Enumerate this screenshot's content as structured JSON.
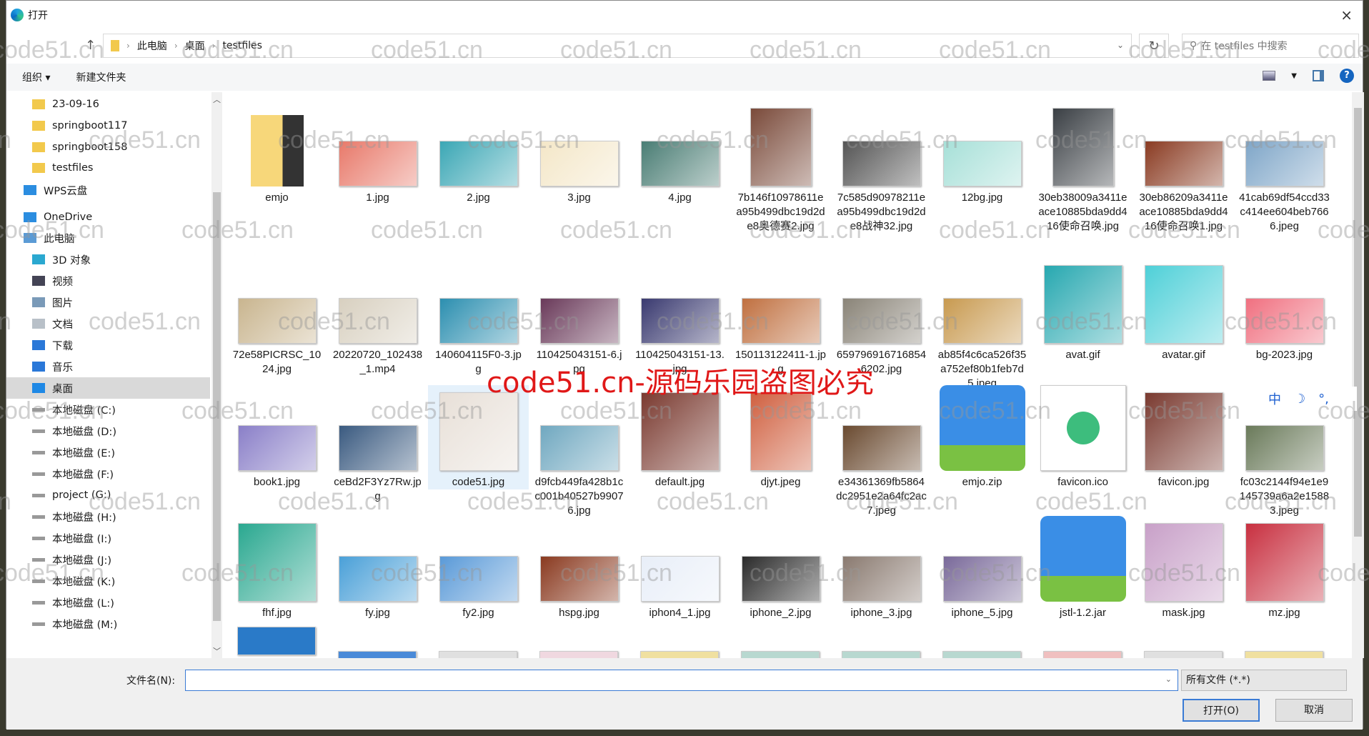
{
  "window": {
    "title": "打开",
    "close": "×"
  },
  "address": {
    "crumbs": [
      "此电脑",
      "桌面",
      "testfiles"
    ],
    "search_placeholder": "在 testfiles 中搜索"
  },
  "toolbar": {
    "organize": "组织 ▾",
    "new_folder": "新建文件夹"
  },
  "sidebar": {
    "items": [
      {
        "label": "23-09-16",
        "icon": "folder-icon"
      },
      {
        "label": "springboot117",
        "icon": "folder-icon"
      },
      {
        "label": "springboot158",
        "icon": "folder-icon"
      },
      {
        "label": "testfiles",
        "icon": "folder-icon"
      },
      {
        "label": "WPS云盘",
        "icon": "cloud-icon"
      },
      {
        "label": "OneDrive",
        "icon": "cloud-icon"
      },
      {
        "label": "此电脑",
        "icon": "computer-icon"
      },
      {
        "label": "3D 对象",
        "icon": "cube-icon"
      },
      {
        "label": "视频",
        "icon": "video-icon"
      },
      {
        "label": "图片",
        "icon": "picture-icon"
      },
      {
        "label": "文档",
        "icon": "document-icon"
      },
      {
        "label": "下载",
        "icon": "download-icon"
      },
      {
        "label": "音乐",
        "icon": "music-icon"
      },
      {
        "label": "桌面",
        "icon": "desktop-icon",
        "selected": true
      },
      {
        "label": "本地磁盘 (C:)",
        "icon": "drive-icon"
      },
      {
        "label": "本地磁盘 (D:)",
        "icon": "drive-icon"
      },
      {
        "label": "本地磁盘 (E:)",
        "icon": "drive-icon"
      },
      {
        "label": "本地磁盘 (F:)",
        "icon": "drive-icon"
      },
      {
        "label": "project (G:)",
        "icon": "drive-icon"
      },
      {
        "label": "本地磁盘 (H:)",
        "icon": "drive-icon"
      },
      {
        "label": "本地磁盘 (I:)",
        "icon": "drive-icon"
      },
      {
        "label": "本地磁盘 (J:)",
        "icon": "drive-icon"
      },
      {
        "label": "本地磁盘 (K:)",
        "icon": "drive-icon"
      },
      {
        "label": "本地磁盘 (L:)",
        "icon": "drive-icon"
      },
      {
        "label": "本地磁盘 (M:)",
        "icon": "drive-icon"
      }
    ]
  },
  "files": [
    {
      "name": "emjo",
      "kind": "folder",
      "color": "#f2c94c"
    },
    {
      "name": "1.jpg",
      "kind": "image",
      "color": "#e8796a"
    },
    {
      "name": "2.jpg",
      "kind": "image",
      "color": "#3ba7b5"
    },
    {
      "name": "3.jpg",
      "kind": "image",
      "color": "#f4e7c8"
    },
    {
      "name": "4.jpg",
      "kind": "image",
      "color": "#4a7d74"
    },
    {
      "name": "7b146f10978611ea95b499dbc19d2de8奥德赛2.jpg",
      "kind": "image-tall",
      "color": "#7a4a3a"
    },
    {
      "name": "7c585d90978211ea95b499dbc19d2de8战神32.jpg",
      "kind": "image",
      "color": "#555555"
    },
    {
      "name": "12bg.jpg",
      "kind": "image",
      "color": "#a7e0d8"
    },
    {
      "name": "30eb38009a3411eace10885bda9dd416使命召唤.jpg",
      "kind": "image-tall",
      "color": "#3a3f44"
    },
    {
      "name": "30eb86209a3411eace10885bda9dd416使命召唤1.jpg",
      "kind": "image",
      "color": "#8a3b22"
    },
    {
      "name": "41cab69df54ccd33c414ee604beb7666.jpeg",
      "kind": "image",
      "color": "#7fa6c8"
    },
    {
      "name": "72e58PICRSC_1024.jpg",
      "kind": "image",
      "color": "#c9b58f"
    },
    {
      "name": "20220720_102438_1.mp4",
      "kind": "video",
      "color": "#d8d0c0"
    },
    {
      "name": "140604115F0-3.jpg",
      "kind": "image",
      "color": "#2c8fb0"
    },
    {
      "name": "110425043151-6.jpg",
      "kind": "image",
      "color": "#6a3a5a"
    },
    {
      "name": "110425043151-13.jpg",
      "kind": "image",
      "color": "#3a3a70"
    },
    {
      "name": "150113122411-1.jpg",
      "kind": "image",
      "color": "#c07040"
    },
    {
      "name": "6597969167168546202.jpg",
      "kind": "image",
      "color": "#8a8478"
    },
    {
      "name": "ab85f4c6ca526f35a752ef80b1feb7d5.jpeg",
      "kind": "image",
      "color": "#c89a50"
    },
    {
      "name": "avat.gif",
      "kind": "image-square",
      "color": "#27a8b0"
    },
    {
      "name": "avatar.gif",
      "kind": "image-square",
      "color": "#4fd0d8"
    },
    {
      "name": "bg-2023.jpg",
      "kind": "image",
      "color": "#f07080"
    },
    {
      "name": "book1.jpg",
      "kind": "image",
      "color": "#8a7fc8"
    },
    {
      "name": "ceBd2F3Yz7Rw.jpg",
      "kind": "image",
      "color": "#3a5a80"
    },
    {
      "name": "code51.jpg",
      "kind": "image-square",
      "color": "#e8e0d8",
      "selected": true
    },
    {
      "name": "d9fcb449fa428b1cc001b40527b99076.jpg",
      "kind": "image",
      "color": "#70a8c0"
    },
    {
      "name": "default.jpg",
      "kind": "image-square",
      "color": "#7a3a30"
    },
    {
      "name": "djyt.jpeg",
      "kind": "image-tall",
      "color": "#d06040"
    },
    {
      "name": "e34361369fb5864dc2951e2a64fc2ac7.jpeg",
      "kind": "image",
      "color": "#6a4a30"
    },
    {
      "name": "emjo.zip",
      "kind": "zip",
      "color": "#3a8ee6"
    },
    {
      "name": "favicon.ico",
      "kind": "ico",
      "color": "#3dbd7d"
    },
    {
      "name": "favicon.jpg",
      "kind": "image-square",
      "color": "#7a3a30"
    },
    {
      "name": "fc03c2144f94e1e9145739a6a2e15883.jpeg",
      "kind": "image",
      "color": "#6a7a5a"
    },
    {
      "name": "fhf.jpg",
      "kind": "image-square",
      "color": "#2aa890"
    },
    {
      "name": "fy.jpg",
      "kind": "image",
      "color": "#4aa0d8"
    },
    {
      "name": "fy2.jpg",
      "kind": "image",
      "color": "#5a9ad8"
    },
    {
      "name": "hspg.jpg",
      "kind": "image",
      "color": "#8a3a20"
    },
    {
      "name": "iphon4_1.jpg",
      "kind": "image",
      "color": "#e8eef8"
    },
    {
      "name": "iphone_2.jpg",
      "kind": "image",
      "color": "#2a2a2a"
    },
    {
      "name": "iphone_3.jpg",
      "kind": "image",
      "color": "#8a7a70"
    },
    {
      "name": "iphone_5.jpg",
      "kind": "image",
      "color": "#7a6a9a"
    },
    {
      "name": "jstl-1.2.jar",
      "kind": "zip",
      "color": "#3a8ee6"
    },
    {
      "name": "mask.jpg",
      "kind": "image-square",
      "color": "#c8a0c8"
    },
    {
      "name": "mz.jpg",
      "kind": "image-square",
      "color": "#c83040"
    }
  ],
  "partial_row_colors": [
    "#2a7ac8",
    "#4a8ad8",
    "#e0e0e0",
    "#f0d8e0",
    "#f0e0a0",
    "#b8d8d0",
    "#b8d8d0",
    "#b8d8d0",
    "#f0c0c0",
    "#e0e0e0",
    "#f0e0a0"
  ],
  "bottom": {
    "filename_label": "文件名(N):",
    "filename_value": "",
    "filter": "所有文件 (*.*)",
    "open": "打开(O)",
    "cancel": "取消"
  },
  "watermark": {
    "text": "code51.cn",
    "red_text": "code51.cn-源码乐园盗图必究"
  },
  "ime": {
    "lang": "中",
    "moon": "☽",
    "dots": "°,"
  }
}
